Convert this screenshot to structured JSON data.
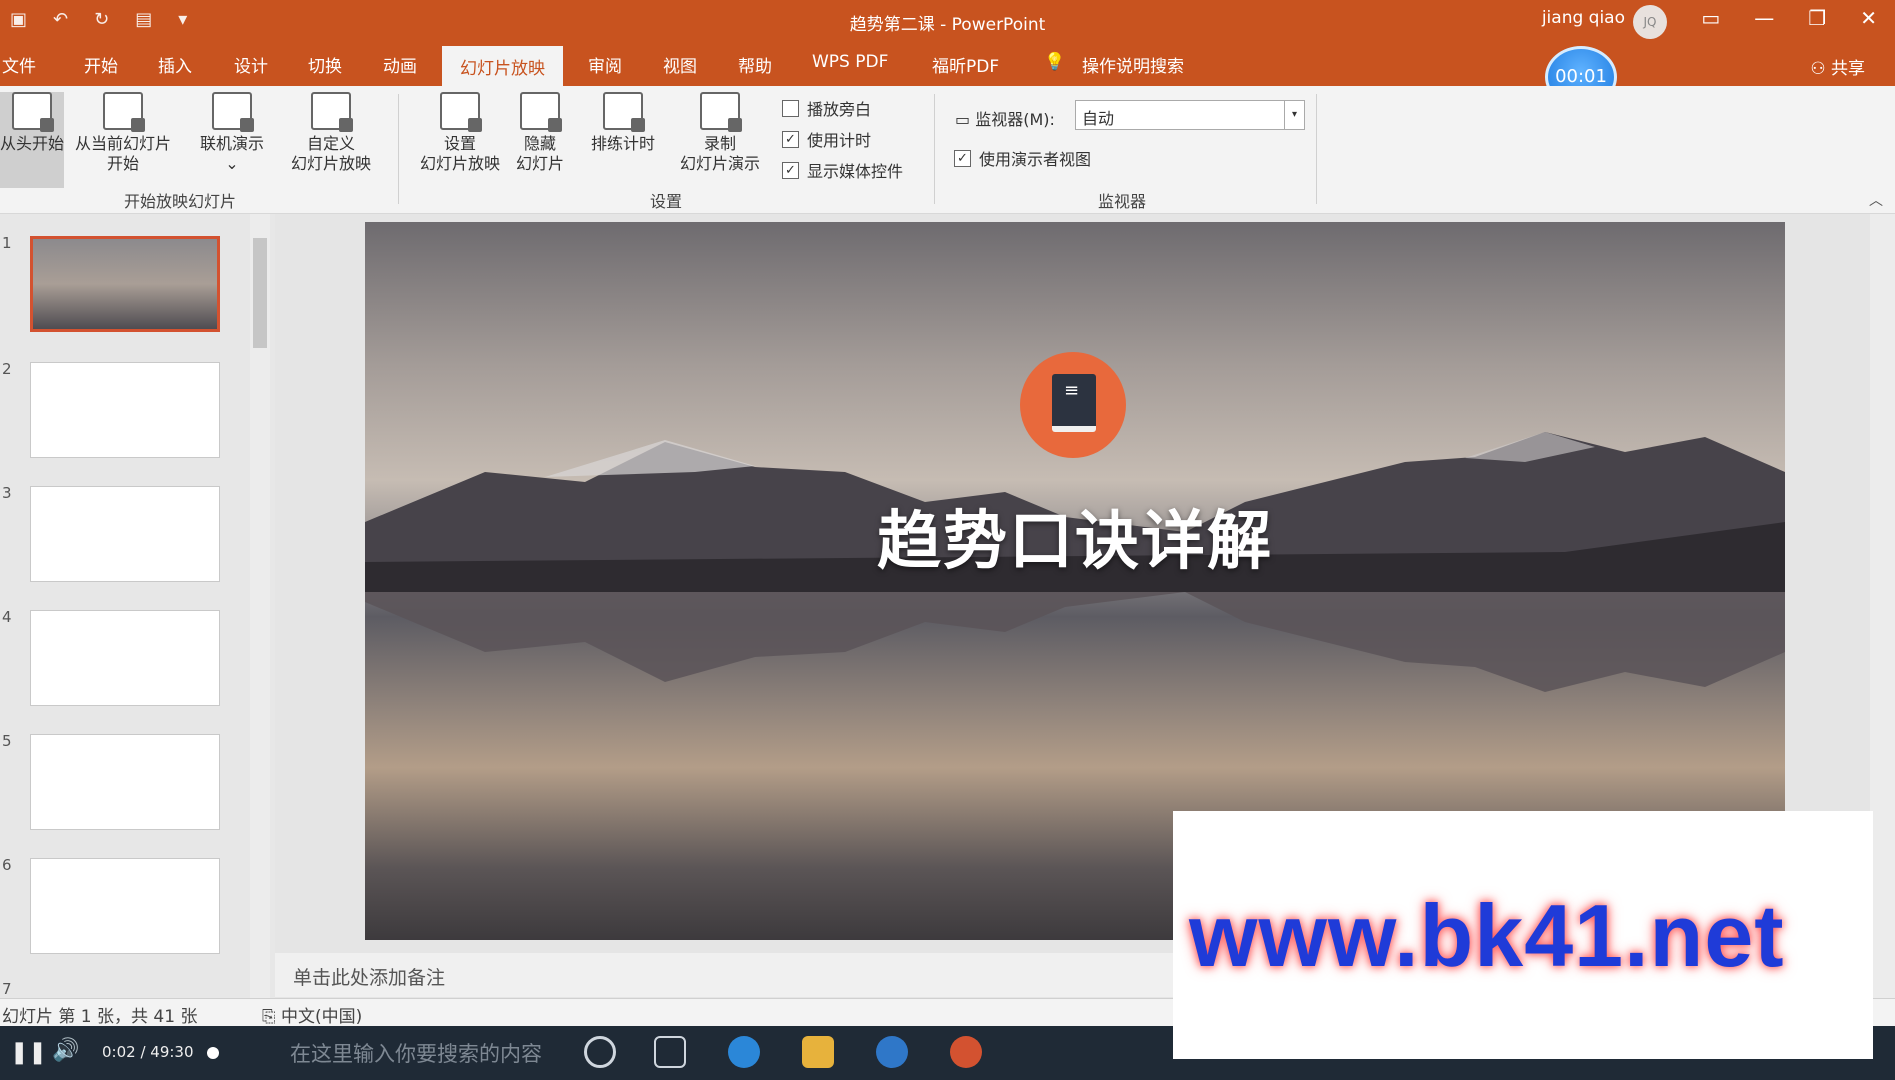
{
  "window": {
    "title": "趋势第二课  -  PowerPoint",
    "user": "jiang qiao",
    "avatar": "JQ"
  },
  "tabs": [
    "文件",
    "开始",
    "插入",
    "设计",
    "切换",
    "动画",
    "幻灯片放映",
    "审阅",
    "视图",
    "帮助",
    "WPS PDF",
    "福昕PDF",
    "操作说明搜索"
  ],
  "active_tab": "幻灯片放映",
  "share": "共享",
  "timer": "00:01",
  "ribbon": {
    "start_group": {
      "label": "开始放映幻灯片",
      "from_start": "从头开始",
      "from_current_l1": "从当前幻灯片",
      "from_current_l2": "开始",
      "online": "联机演示",
      "custom_l1": "自定义",
      "custom_l2": "幻灯片放映"
    },
    "setup_group": {
      "label": "设置",
      "setup_l1": "设置",
      "setup_l2": "幻灯片放映",
      "hide_l1": "隐藏",
      "hide_l2": "幻灯片",
      "rehearse": "排练计时",
      "record_l1": "录制",
      "record_l2": "幻灯片演示",
      "play_narration": "播放旁白",
      "use_timings": "使用计时",
      "show_media": "显示媒体控件"
    },
    "monitor_group": {
      "label": "监视器",
      "monitor_label": "监视器(M):",
      "monitor_value": "自动",
      "presenter_view": "使用演示者视图"
    }
  },
  "thumbnails": [
    {
      "num": "1"
    },
    {
      "num": "2"
    },
    {
      "num": "3"
    },
    {
      "num": "4"
    },
    {
      "num": "5"
    },
    {
      "num": "6"
    },
    {
      "num": "7"
    }
  ],
  "slide": {
    "title": "趋势口诀详解"
  },
  "notes_placeholder": "单击此处添加备注",
  "status": {
    "slide_info": "幻灯片 第 1 张，共 41 张",
    "language": "中文(中国)"
  },
  "player": {
    "time": "0:02  /  49:30",
    "search": "在这里输入你要搜索的内容"
  },
  "watermark": "www.bk41.net"
}
